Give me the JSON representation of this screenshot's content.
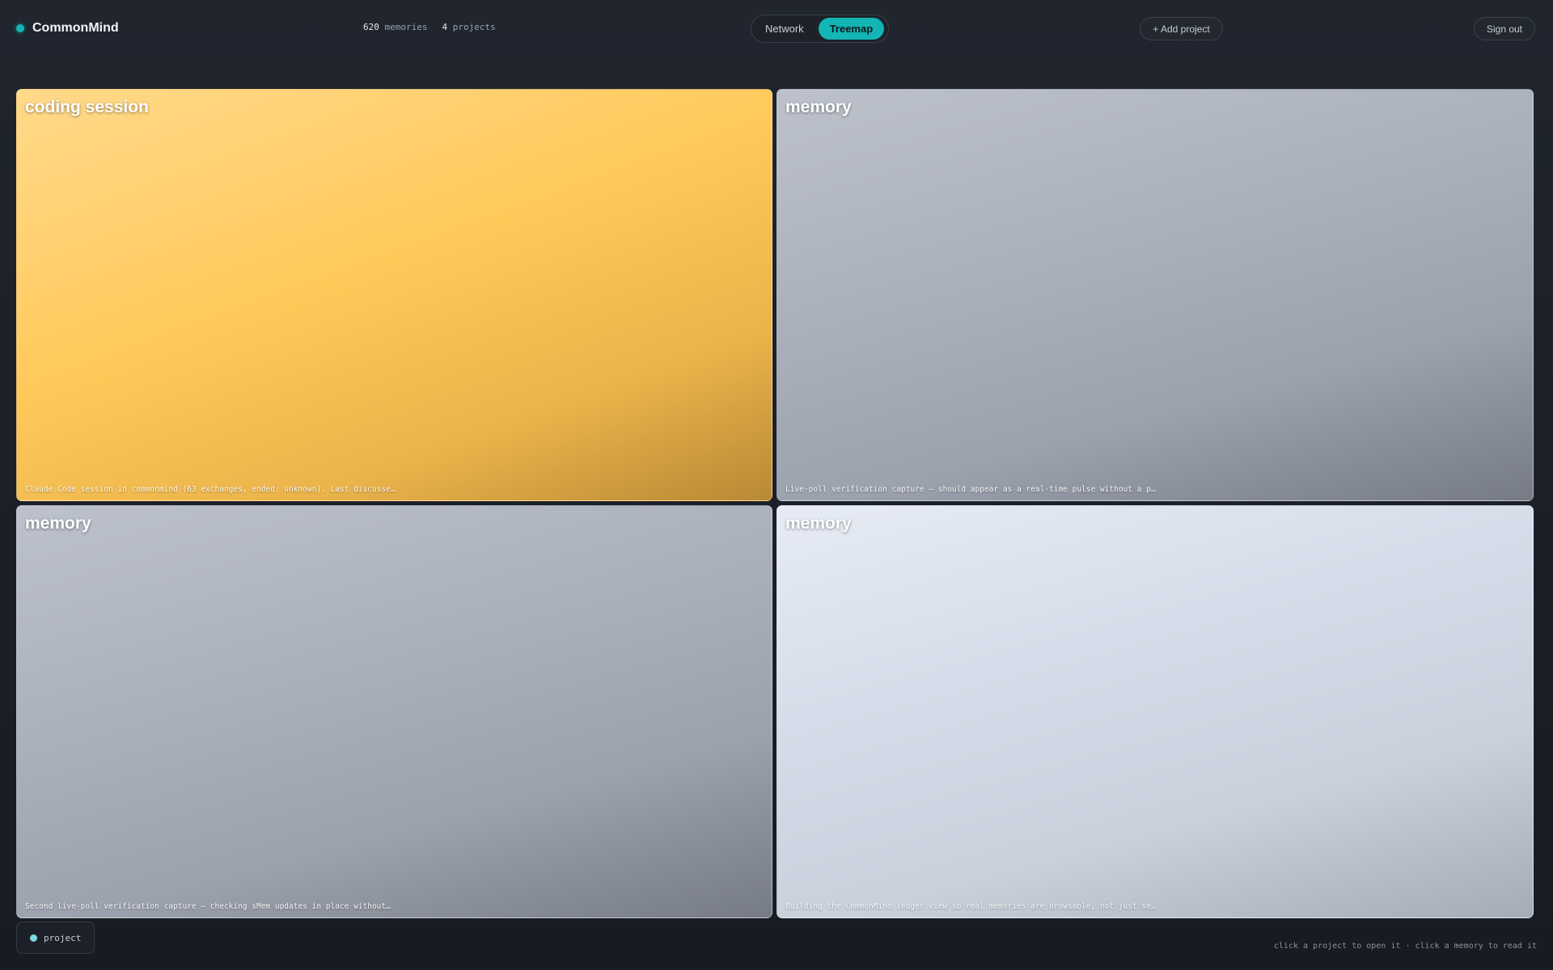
{
  "app": {
    "name": "CommonMind"
  },
  "stats": {
    "memories_count": "620",
    "memories_label": "memories",
    "projects_count": "4",
    "projects_label": "projects"
  },
  "view_toggle": {
    "options": [
      "Network",
      "Treemap"
    ],
    "selected": "Treemap"
  },
  "actions": {
    "add_project": "+ Add project",
    "sign_out": "Sign out"
  },
  "treemap": {
    "tiles": [
      {
        "title": "coding session",
        "snippet": "Claude Code session in commonmind (63 exchanges, ended: unknown). Last discusse…",
        "color": "#ffc95a"
      },
      {
        "title": "memory",
        "snippet": "Live-poll verification capture — should appear as a real-time pulse without a p…",
        "color": "#a8aeb9"
      },
      {
        "title": "memory",
        "snippet": "Second live-poll verification capture — checking sMem updates in place without…",
        "color": "#a8aeb9"
      },
      {
        "title": "memory",
        "snippet": "Building the CommonMind ledger view so real memories are browsable, not just se…",
        "color": "#d4dbe8"
      }
    ]
  },
  "legend": {
    "label": "project",
    "color": "#7dd8e6"
  },
  "hint": "click a project to open it · click a memory to read it",
  "colors": {
    "accent": "#13b5b5"
  }
}
